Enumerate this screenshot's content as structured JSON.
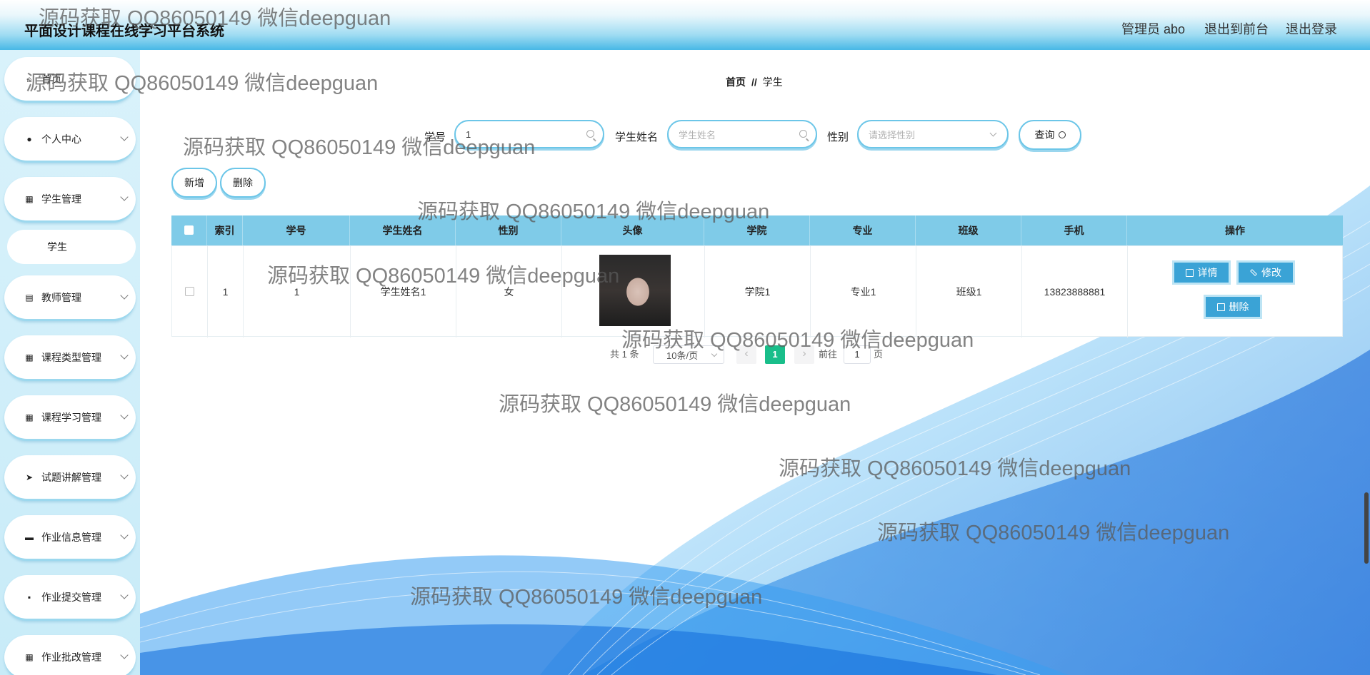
{
  "header": {
    "title": "平面设计课程在线学习平台系统",
    "user_label": "管理员 abo",
    "to_frontend": "退出到前台",
    "logout": "退出登录"
  },
  "sidebar": {
    "items": [
      {
        "label": "首页",
        "icon": "home-icon"
      },
      {
        "label": "个人中心",
        "icon": "person-icon"
      },
      {
        "label": "学生管理",
        "icon": "grid-icon"
      },
      {
        "label": "教师管理",
        "icon": "chart-icon"
      },
      {
        "label": "课程类型管理",
        "icon": "grid-icon"
      },
      {
        "label": "课程学习管理",
        "icon": "grid-icon"
      },
      {
        "label": "试题讲解管理",
        "icon": "send-icon"
      },
      {
        "label": "作业信息管理",
        "icon": "monitor-icon"
      },
      {
        "label": "作业提交管理",
        "icon": "chat-icon"
      },
      {
        "label": "作业批改管理",
        "icon": "grid-icon"
      }
    ],
    "sub_item": "学生"
  },
  "breadcrumb": {
    "home": "首页",
    "sep": "//",
    "current": "学生"
  },
  "search": {
    "student_no_label": "学号",
    "student_no_value": "1",
    "name_label": "学生姓名",
    "name_placeholder": "学生姓名",
    "gender_label": "性别",
    "gender_placeholder": "请选择性别",
    "query_button": "查询"
  },
  "actions": {
    "add": "新增",
    "delete": "删除"
  },
  "table": {
    "columns": [
      "索引",
      "学号",
      "学生姓名",
      "性别",
      "头像",
      "学院",
      "专业",
      "班级",
      "手机",
      "操作"
    ],
    "rows": [
      {
        "index": "1",
        "student_no": "1",
        "name": "学生姓名1",
        "gender": "女",
        "college": "学院1",
        "major": "专业1",
        "class": "班级1",
        "phone": "13823888881"
      }
    ],
    "row_actions": {
      "detail": "详情",
      "edit": "修改",
      "delete": "删除"
    }
  },
  "pagination": {
    "total": "共 1 条",
    "page_size": "10条/页",
    "current_page": "1",
    "goto_label": "前往",
    "goto_value": "1",
    "page_suffix": "页"
  },
  "watermark": "源码获取 QQ86050149 微信deepguan",
  "colors": {
    "header_gradient_end": "#48b8e6",
    "table_header": "#7fcbe8",
    "action_button": "#3aa3d6",
    "active_page": "#19be8a"
  }
}
